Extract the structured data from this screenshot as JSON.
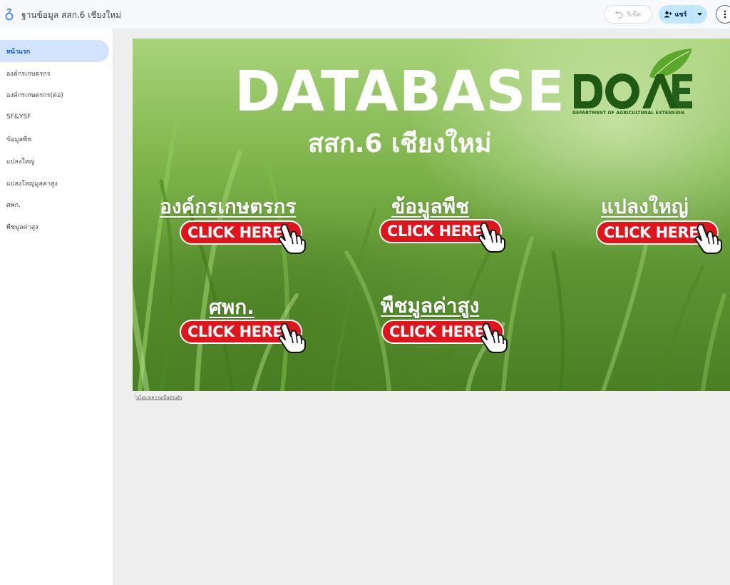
{
  "header": {
    "title": "ฐานข้อมูล สสก.6 เชียงใหม่",
    "reset_label": "รีเซ็ต",
    "share_label": "แชร์"
  },
  "sidebar": {
    "items": [
      {
        "label": "หน้าแรก",
        "active": true
      },
      {
        "label": "องค์กรเกษตรกร",
        "active": false
      },
      {
        "label": "องค์กรเกษตรกร(ต่อ)",
        "active": false
      },
      {
        "label": "SF&YSF",
        "active": false
      },
      {
        "label": "ข้อมูลพืช",
        "active": false
      },
      {
        "label": "แปลงใหญ่",
        "active": false
      },
      {
        "label": "แปลงใหญ่มูลค่าสูง",
        "active": false
      },
      {
        "label": "ศพก.",
        "active": false
      },
      {
        "label": "พืชมูลค่าสูง",
        "active": false
      }
    ]
  },
  "banner": {
    "title": "DATABASE",
    "subtitle": "สสก.6 เชียงใหม่",
    "logo_caption": "DEPARTMENT OF AGRICULTURAL EXTENSION",
    "cta_label": "CLICK HERE",
    "categories": [
      {
        "title": "องค์กรเกษตรกร"
      },
      {
        "title": "ข้อมูลพืช"
      },
      {
        "title": "แปลงใหญ่"
      },
      {
        "title": "ศพก."
      },
      {
        "title": "พืชมูลค่าสูง"
      }
    ]
  },
  "footer": {
    "privacy_link": "นโยบายความเป็นส่วนตัว"
  },
  "colors": {
    "accent": "#0b57d0",
    "active_nav_bg": "#d3e3fd",
    "share_bg": "#c2e7ff",
    "cta_red": "#e0141b",
    "logo_green": "#1e5a14"
  },
  "icons": [
    "app-logo-icon",
    "undo-icon",
    "add-person-icon",
    "caret-down-icon",
    "more-vert-icon",
    "pointing-hand-icon",
    "leaf-icon"
  ]
}
